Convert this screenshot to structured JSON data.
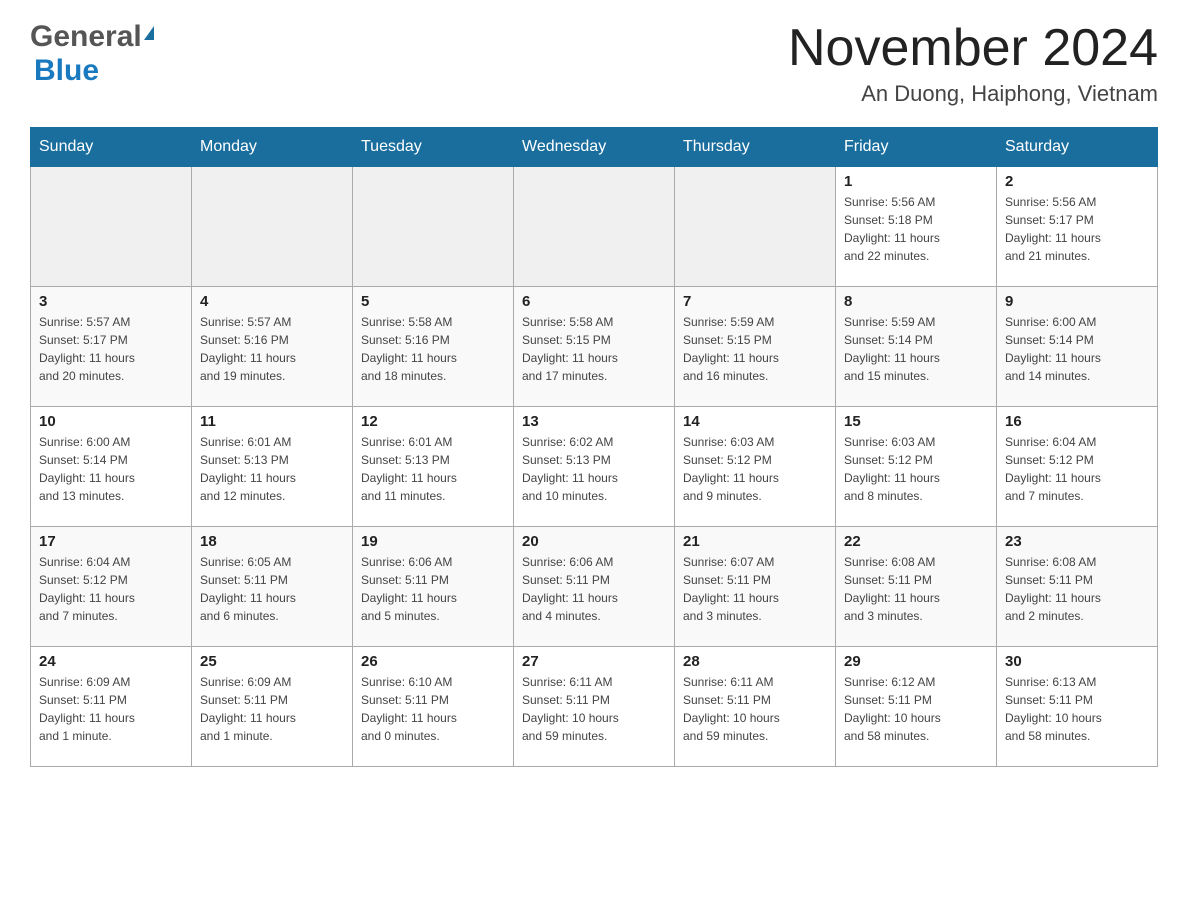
{
  "header": {
    "logo_general": "General",
    "logo_blue": "Blue",
    "title": "November 2024",
    "location": "An Duong, Haiphong, Vietnam"
  },
  "weekdays": [
    "Sunday",
    "Monday",
    "Tuesday",
    "Wednesday",
    "Thursday",
    "Friday",
    "Saturday"
  ],
  "weeks": [
    [
      {
        "day": "",
        "info": ""
      },
      {
        "day": "",
        "info": ""
      },
      {
        "day": "",
        "info": ""
      },
      {
        "day": "",
        "info": ""
      },
      {
        "day": "",
        "info": ""
      },
      {
        "day": "1",
        "info": "Sunrise: 5:56 AM\nSunset: 5:18 PM\nDaylight: 11 hours\nand 22 minutes."
      },
      {
        "day": "2",
        "info": "Sunrise: 5:56 AM\nSunset: 5:17 PM\nDaylight: 11 hours\nand 21 minutes."
      }
    ],
    [
      {
        "day": "3",
        "info": "Sunrise: 5:57 AM\nSunset: 5:17 PM\nDaylight: 11 hours\nand 20 minutes."
      },
      {
        "day": "4",
        "info": "Sunrise: 5:57 AM\nSunset: 5:16 PM\nDaylight: 11 hours\nand 19 minutes."
      },
      {
        "day": "5",
        "info": "Sunrise: 5:58 AM\nSunset: 5:16 PM\nDaylight: 11 hours\nand 18 minutes."
      },
      {
        "day": "6",
        "info": "Sunrise: 5:58 AM\nSunset: 5:15 PM\nDaylight: 11 hours\nand 17 minutes."
      },
      {
        "day": "7",
        "info": "Sunrise: 5:59 AM\nSunset: 5:15 PM\nDaylight: 11 hours\nand 16 minutes."
      },
      {
        "day": "8",
        "info": "Sunrise: 5:59 AM\nSunset: 5:14 PM\nDaylight: 11 hours\nand 15 minutes."
      },
      {
        "day": "9",
        "info": "Sunrise: 6:00 AM\nSunset: 5:14 PM\nDaylight: 11 hours\nand 14 minutes."
      }
    ],
    [
      {
        "day": "10",
        "info": "Sunrise: 6:00 AM\nSunset: 5:14 PM\nDaylight: 11 hours\nand 13 minutes."
      },
      {
        "day": "11",
        "info": "Sunrise: 6:01 AM\nSunset: 5:13 PM\nDaylight: 11 hours\nand 12 minutes."
      },
      {
        "day": "12",
        "info": "Sunrise: 6:01 AM\nSunset: 5:13 PM\nDaylight: 11 hours\nand 11 minutes."
      },
      {
        "day": "13",
        "info": "Sunrise: 6:02 AM\nSunset: 5:13 PM\nDaylight: 11 hours\nand 10 minutes."
      },
      {
        "day": "14",
        "info": "Sunrise: 6:03 AM\nSunset: 5:12 PM\nDaylight: 11 hours\nand 9 minutes."
      },
      {
        "day": "15",
        "info": "Sunrise: 6:03 AM\nSunset: 5:12 PM\nDaylight: 11 hours\nand 8 minutes."
      },
      {
        "day": "16",
        "info": "Sunrise: 6:04 AM\nSunset: 5:12 PM\nDaylight: 11 hours\nand 7 minutes."
      }
    ],
    [
      {
        "day": "17",
        "info": "Sunrise: 6:04 AM\nSunset: 5:12 PM\nDaylight: 11 hours\nand 7 minutes."
      },
      {
        "day": "18",
        "info": "Sunrise: 6:05 AM\nSunset: 5:11 PM\nDaylight: 11 hours\nand 6 minutes."
      },
      {
        "day": "19",
        "info": "Sunrise: 6:06 AM\nSunset: 5:11 PM\nDaylight: 11 hours\nand 5 minutes."
      },
      {
        "day": "20",
        "info": "Sunrise: 6:06 AM\nSunset: 5:11 PM\nDaylight: 11 hours\nand 4 minutes."
      },
      {
        "day": "21",
        "info": "Sunrise: 6:07 AM\nSunset: 5:11 PM\nDaylight: 11 hours\nand 3 minutes."
      },
      {
        "day": "22",
        "info": "Sunrise: 6:08 AM\nSunset: 5:11 PM\nDaylight: 11 hours\nand 3 minutes."
      },
      {
        "day": "23",
        "info": "Sunrise: 6:08 AM\nSunset: 5:11 PM\nDaylight: 11 hours\nand 2 minutes."
      }
    ],
    [
      {
        "day": "24",
        "info": "Sunrise: 6:09 AM\nSunset: 5:11 PM\nDaylight: 11 hours\nand 1 minute."
      },
      {
        "day": "25",
        "info": "Sunrise: 6:09 AM\nSunset: 5:11 PM\nDaylight: 11 hours\nand 1 minute."
      },
      {
        "day": "26",
        "info": "Sunrise: 6:10 AM\nSunset: 5:11 PM\nDaylight: 11 hours\nand 0 minutes."
      },
      {
        "day": "27",
        "info": "Sunrise: 6:11 AM\nSunset: 5:11 PM\nDaylight: 10 hours\nand 59 minutes."
      },
      {
        "day": "28",
        "info": "Sunrise: 6:11 AM\nSunset: 5:11 PM\nDaylight: 10 hours\nand 59 minutes."
      },
      {
        "day": "29",
        "info": "Sunrise: 6:12 AM\nSunset: 5:11 PM\nDaylight: 10 hours\nand 58 minutes."
      },
      {
        "day": "30",
        "info": "Sunrise: 6:13 AM\nSunset: 5:11 PM\nDaylight: 10 hours\nand 58 minutes."
      }
    ]
  ]
}
